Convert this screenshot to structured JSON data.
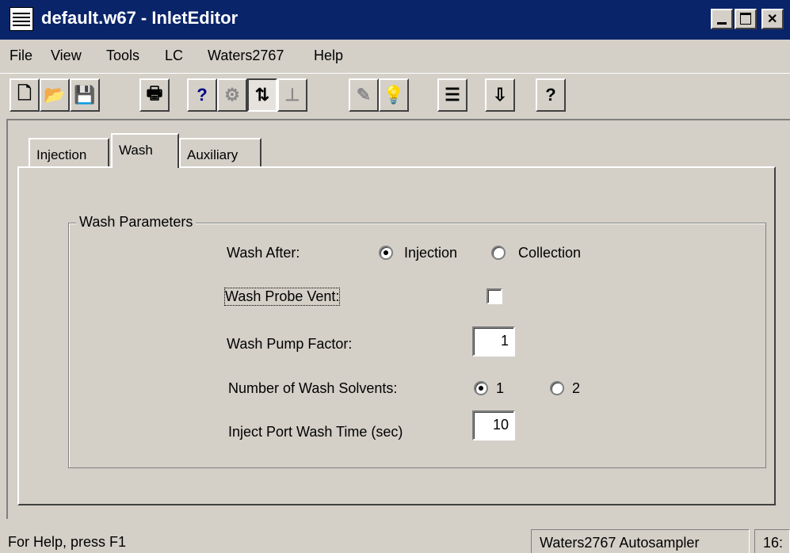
{
  "window": {
    "title": "default.w67 - InletEditor",
    "app_icon": "document-icon",
    "controls": [
      "minimize",
      "maximize",
      "close"
    ]
  },
  "menu": {
    "items": [
      {
        "label": "File"
      },
      {
        "label": "View"
      },
      {
        "label": "Tools"
      },
      {
        "label": "LC"
      },
      {
        "label": "Waters2767"
      },
      {
        "label": "Help"
      }
    ]
  },
  "toolbar": {
    "buttons": [
      {
        "icon": "new-document-icon",
        "glyph": "🗋",
        "state": "enabled"
      },
      {
        "icon": "open-folder-icon",
        "glyph": "📂",
        "state": "enabled"
      },
      {
        "icon": "save-icon",
        "glyph": "💾",
        "state": "enabled"
      },
      {
        "icon": "print-icon",
        "glyph": "🖶",
        "state": "enabled"
      },
      {
        "icon": "context-help-icon",
        "glyph": "?",
        "state": "enabled"
      },
      {
        "icon": "instrument-icon",
        "glyph": "⚙",
        "state": "disabled"
      },
      {
        "icon": "inlet-method-icon",
        "glyph": "⇅",
        "state": "pressed"
      },
      {
        "icon": "chromatogram-icon",
        "glyph": "⊥",
        "state": "disabled"
      },
      {
        "icon": "edit-icon",
        "glyph": "✎",
        "state": "disabled"
      },
      {
        "icon": "lamp-icon",
        "glyph": "💡",
        "state": "disabled"
      },
      {
        "icon": "list-icon",
        "glyph": "☰",
        "state": "enabled"
      },
      {
        "icon": "download-icon",
        "glyph": "⇩",
        "state": "enabled"
      },
      {
        "icon": "help-icon",
        "glyph": "?",
        "state": "enabled"
      }
    ]
  },
  "tabs": [
    {
      "label": "Injection",
      "active": false
    },
    {
      "label": "Wash",
      "active": true
    },
    {
      "label": "Auxiliary",
      "active": false
    }
  ],
  "wash_parameters": {
    "group_label": "Wash Parameters",
    "wash_after": {
      "label": "Wash After:",
      "options": [
        "Injection",
        "Collection"
      ],
      "selected": "Injection"
    },
    "wash_probe_vent": {
      "label": "Wash Probe Vent:",
      "checked": false
    },
    "wash_pump_factor": {
      "label": "Wash Pump Factor:",
      "value": "1"
    },
    "number_of_wash_solvents": {
      "label": "Number of Wash Solvents:",
      "options": [
        "1",
        "2"
      ],
      "selected": "1"
    },
    "inject_port_wash_time": {
      "label": "Inject Port Wash Time (sec)",
      "value": "10"
    }
  },
  "status_bar": {
    "help_text": "For Help, press F1",
    "instrument": "Waters2767 Autosampler",
    "extra": "16:"
  }
}
